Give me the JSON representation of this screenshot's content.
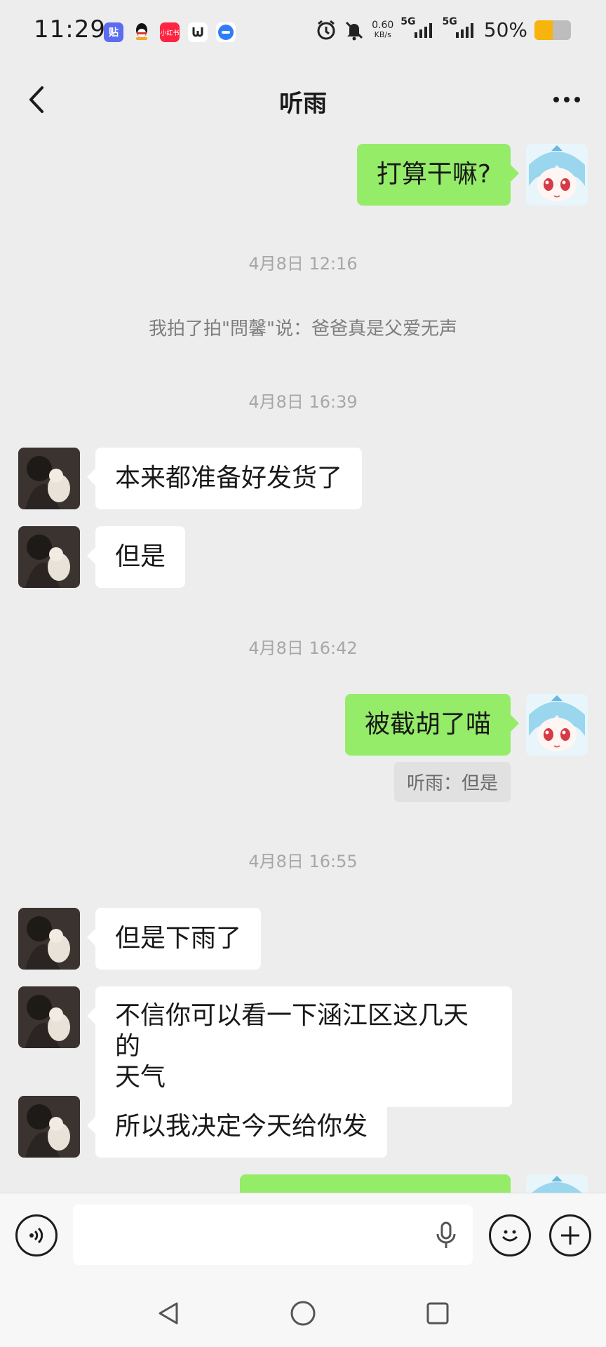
{
  "status_bar": {
    "time": "11:29",
    "app_icons": [
      {
        "name": "tieba-icon",
        "glyph": "贴",
        "color": "#5b6cf0"
      },
      {
        "name": "qq-icon",
        "glyph": "🐧",
        "color": "#ffffff"
      },
      {
        "name": "xiaohongshu-icon",
        "glyph": "小红书",
        "color": "#ff2442"
      },
      {
        "name": "app-icon",
        "glyph": "ပ",
        "color": "#ffffff"
      },
      {
        "name": "message-app-icon",
        "glyph": "⊖",
        "color": "#2f7df6"
      }
    ],
    "net_speed_value": "0.60",
    "net_speed_unit": "KB/s",
    "signal_1": "5G",
    "signal_2": "5G",
    "battery_text": "50%",
    "battery_level": 0.5
  },
  "header": {
    "title": "听雨"
  },
  "messages": {
    "m1": "打算干嘛?",
    "t1": "4月8日 12:16",
    "sys1": "我拍了拍\"問馨\"说：爸爸真是父爱无声",
    "t2": "4月8日 16:39",
    "m2": "本来都准备好发货了",
    "m3": "但是",
    "t3": "4月8日 16:42",
    "m4": "被截胡了喵",
    "q4": "听雨：但是",
    "t4": "4月8日 16:55",
    "m5": "但是下雨了",
    "m6_line1": "不信你可以看一下涵江区这几天的",
    "m6_line2": "天气",
    "m7": "所以我决定今天给你发"
  },
  "input": {
    "placeholder": ""
  },
  "colors": {
    "background": "#ededed",
    "bubble_self": "#95ec69",
    "bubble_other": "#ffffff"
  }
}
